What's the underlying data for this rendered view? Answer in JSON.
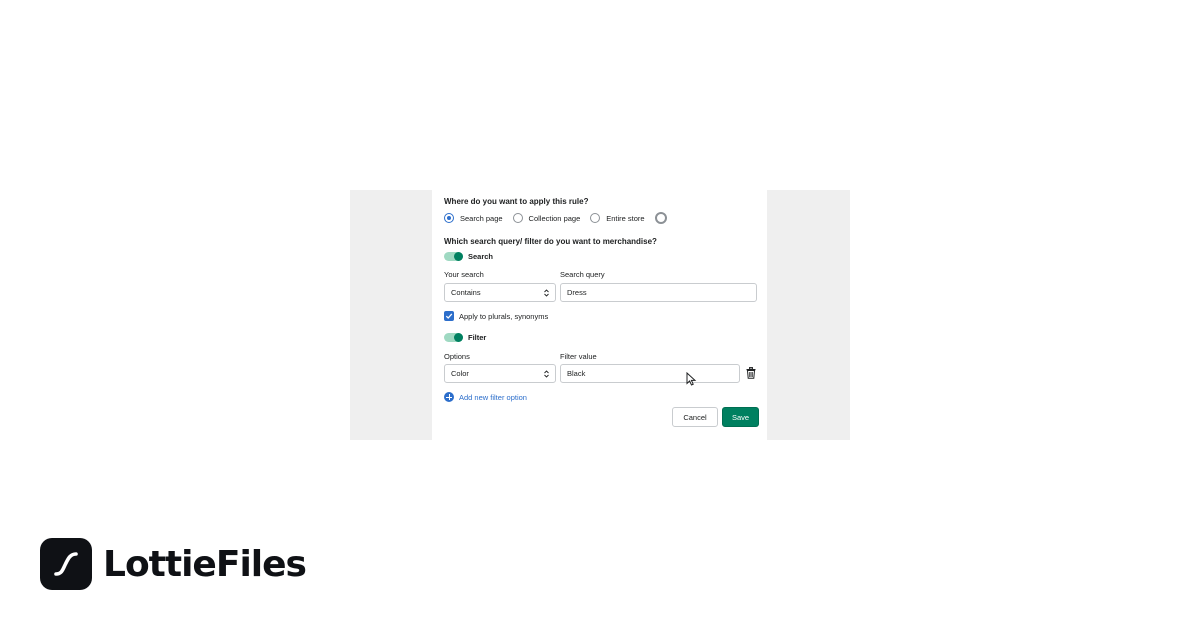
{
  "form": {
    "apply_question": "Where do you want to apply this rule?",
    "apply_options": [
      {
        "label": "Search page",
        "checked": true
      },
      {
        "label": "Collection page",
        "checked": false
      },
      {
        "label": "Entire store",
        "checked": false
      }
    ],
    "merch_question": "Which search query/ filter do you want to merchandise?",
    "search_toggle_label": "Search",
    "your_search_label": "Your search",
    "your_search_value": "Contains",
    "search_query_label": "Search query",
    "search_query_value": "Dress",
    "plurals_label": "Apply to plurals, synonyms",
    "plurals_checked": true,
    "filter_toggle_label": "Filter",
    "options_label": "Options",
    "options_value": "Color",
    "filter_value_label": "Filter value",
    "filter_value": "Black",
    "add_filter_label": "Add new filter option",
    "cancel_label": "Cancel",
    "save_label": "Save"
  },
  "brand": {
    "name": "LottieFiles"
  },
  "colors": {
    "accent": "#2c6ecb",
    "primary_button": "#008060",
    "toggle_track": "#9fd9c2"
  },
  "icons": [
    "spinner-icon",
    "select-arrows-icon",
    "checkmark-icon",
    "trash-icon",
    "plus-circle-icon",
    "mouse-cursor-icon",
    "lottiefiles-logo-icon"
  ]
}
